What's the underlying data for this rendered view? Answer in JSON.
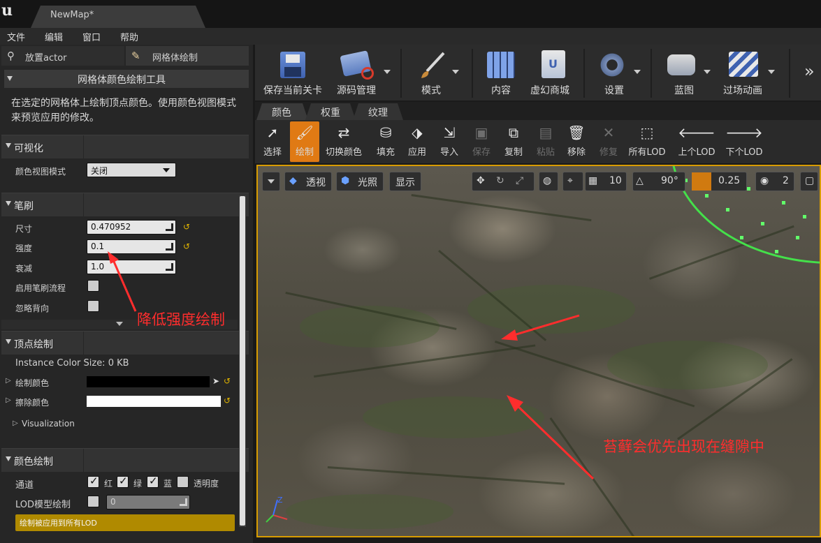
{
  "title_bar": {
    "map_tab": "NewMap*",
    "logo": "ue-logo"
  },
  "menu": [
    "文件",
    "编辑",
    "窗口",
    "帮助"
  ],
  "left_panel": {
    "tabs": [
      {
        "label": "放置actor",
        "icon": "place-actor-icon"
      },
      {
        "label": "网格体绘制",
        "icon": "brush-icon"
      }
    ],
    "tool_title": "网格体颜色绘制工具",
    "description": "在选定的网格体上绘制顶点颜色。使用颜色视图模式来预览应用的修改。",
    "sections": {
      "visualization": {
        "title": "可视化",
        "color_view_mode_label": "颜色视图模式",
        "color_view_mode_value": "关闭"
      },
      "brush": {
        "title": "笔刷",
        "size_label": "尺寸",
        "size_value": "0.470952",
        "strength_label": "强度",
        "strength_value": "0.1",
        "falloff_label": "衰减",
        "falloff_value": "1.0",
        "enable_flow_label": "启用笔刷流程",
        "ignore_backface_label": "忽略背向"
      },
      "vertex_paint": {
        "title": "顶点绘制",
        "instance_color_size": "Instance Color Size: 0 KB",
        "paint_color_label": "绘制颜色",
        "erase_color_label": "擦除颜色",
        "visualization_label": "Visualization"
      },
      "color_paint": {
        "title": "颜色绘制",
        "channel_label": "通道",
        "channels": [
          "红",
          "绿",
          "蓝",
          "透明度"
        ],
        "lod_label": "LOD模型绘制",
        "lod_value": "0",
        "apply_all_lod": "绘制被应用到所有LOD"
      }
    },
    "annotation": "降低强度绘制"
  },
  "toolbar": {
    "buttons": [
      "保存当前关卡",
      "源码管理",
      "模式",
      "内容",
      "虚幻商城",
      "设置",
      "蓝图",
      "过场动画"
    ]
  },
  "mode_tabs": [
    "颜色",
    "权重",
    "纹理"
  ],
  "paint_tools": [
    "选择",
    "绘制",
    "切换颜色",
    "填充",
    "应用",
    "导入",
    "保存",
    "复制",
    "粘贴",
    "移除",
    "修复",
    "所有LOD",
    "上个LOD",
    "下个LOD"
  ],
  "viewport": {
    "perspective": "透视",
    "lighting": "光照",
    "show": "显示",
    "grid_snap": "10",
    "rotation_snap": "90°",
    "scale_snap": "0.25",
    "camera_speed": "2",
    "annotation": "苔藓会优先出现在缝隙中"
  },
  "colors": {
    "accent": "#e07a14",
    "viewport_border": "#d89c00",
    "annotation": "#ff2d2d",
    "lod_button": "#b08a00"
  }
}
